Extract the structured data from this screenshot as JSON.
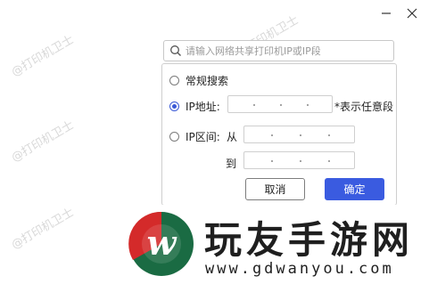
{
  "watermark": {
    "text": "@打印机卫士"
  },
  "window": {
    "minimize_glyph": "—",
    "close_glyph": "✕"
  },
  "search": {
    "icon": "search-icon",
    "placeholder": "请输入网络共享打印机IP或IP段"
  },
  "dropdown": {
    "option_normal": "常规搜索",
    "option_ip": "IP地址:",
    "ip_hint": "*表示任意段",
    "option_range": "IP区间:",
    "range_from": "从",
    "range_to": "到",
    "selected": "IP地址"
  },
  "buttons": {
    "cancel": "取消",
    "confirm": "确定"
  },
  "banner": {
    "brand": "玩友手游网",
    "url": "www.gdwanyou.com",
    "logo_letter": "w",
    "colors": {
      "red": "#d42a2a",
      "green": "#1a6b43"
    }
  }
}
